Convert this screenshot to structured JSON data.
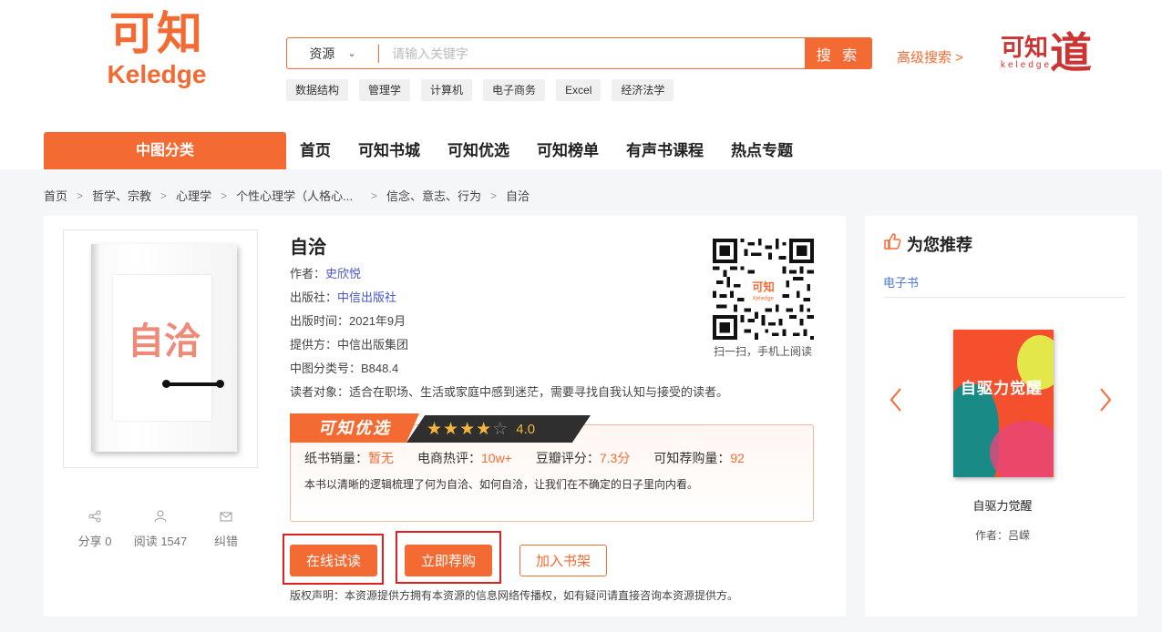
{
  "brand": {
    "logo_cn": "可知",
    "logo_en": "Keledge",
    "logo2_cn": "可知",
    "logo2_en": "keledge",
    "logo2_mark": "道"
  },
  "search": {
    "scope": "资源",
    "placeholder": "请输入关键字",
    "button": "搜 索",
    "advanced": "高级搜索 >"
  },
  "hot_tags": [
    "数据结构",
    "管理学",
    "计算机",
    "电子商务",
    "Excel",
    "经济法学"
  ],
  "nav": {
    "category": "中图分类",
    "items": [
      "首页",
      "可知书城",
      "可知优选",
      "可知榜单",
      "有声书课程",
      "热点专题"
    ]
  },
  "breadcrumb": [
    "首页",
    "哲学、宗教",
    "心理学",
    "个性心理学（人格心...",
    "信念、意志、行为",
    "自洽"
  ],
  "book": {
    "title": "自洽",
    "cover_title": "自洽",
    "author_label": "作者：",
    "author": "史欣悦",
    "publisher_label": "出版社：",
    "publisher": "中信出版社",
    "date_label": "出版时间：",
    "date": "2021年9月",
    "provider_label": "提供方：",
    "provider": "中信出版集团",
    "clc_label": "中图分类号：",
    "clc": "B848.4",
    "audience_label": "读者对象：",
    "audience": "适合在职场、生活或家庭中感到迷茫，需要寻找自我认知与接受的读者。"
  },
  "qr": {
    "caption": "扫一扫，手机上阅读",
    "center_cn": "可知",
    "center_en": "Keledge"
  },
  "pick": {
    "tab": "可知优选",
    "rating": 4.0,
    "rating_text": "4.0",
    "stats": [
      {
        "label": "纸书销量：",
        "value": "暂无"
      },
      {
        "label": "电商热评：",
        "value": "10w+"
      },
      {
        "label": "豆瓣评分：",
        "value": "7.3分"
      },
      {
        "label": "可知荐购量：",
        "value": "92"
      }
    ],
    "description": "本书以清晰的逻辑梳理了何为自洽、如何自洽，让我们在不确定的日子里向内看。"
  },
  "actions": {
    "read": "在线试读",
    "buy": "立即荐购",
    "shelf": "加入书架"
  },
  "copyright": "版权声明：本资源提供方拥有本资源的信息网络传播权，如有疑问请直接咨询本资源提供方。",
  "social": [
    {
      "icon": "share-icon",
      "label": "分享 0"
    },
    {
      "icon": "reader-icon",
      "label": "阅读 1547"
    },
    {
      "icon": "mail-icon",
      "label": "纠错"
    }
  ],
  "recommend": {
    "title": "为您推荐",
    "tab": "电子书",
    "book_title": "自驱力觉醒",
    "cover_title": "自驱力觉醒",
    "author": "作者：吕嵘"
  },
  "colors": {
    "accent": "#f46a33",
    "highlight": "#e02020",
    "link": "#4b54c8"
  }
}
